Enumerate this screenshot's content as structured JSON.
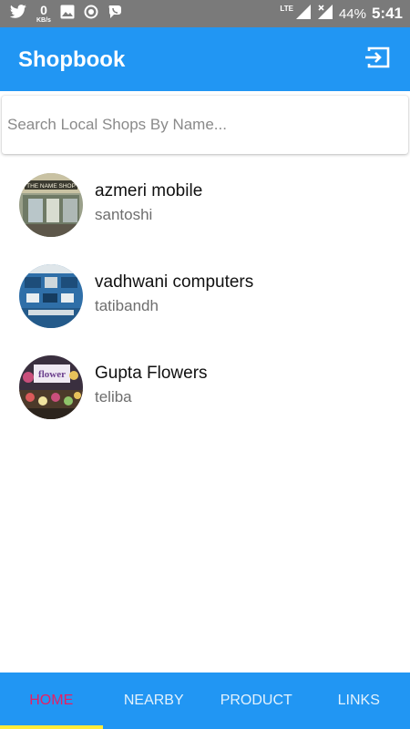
{
  "status_bar": {
    "kbs_value": "0",
    "kbs_unit": "KB/s",
    "network": "LTE",
    "battery": "44%",
    "time": "5:41"
  },
  "app_bar": {
    "title": "Shopbook",
    "action_icon": "logout-icon"
  },
  "search": {
    "placeholder": "Search Local Shops By Name...",
    "value": ""
  },
  "shops": [
    {
      "name": "azmeri mobile",
      "location": "santoshi",
      "sign_text": "THE NAME SHOP"
    },
    {
      "name": "vadhwani computers",
      "location": "tatibandh"
    },
    {
      "name": "Gupta Flowers",
      "location": "teliba",
      "sign_text": "flower"
    }
  ],
  "bottom_nav": {
    "tabs": [
      {
        "label": "HOME",
        "active": true
      },
      {
        "label": "NEARBY",
        "active": false
      },
      {
        "label": "PRODUCT",
        "active": false
      },
      {
        "label": "LINKS",
        "active": false
      }
    ]
  },
  "colors": {
    "primary": "#2196f3",
    "status_bar": "#7a7a7a",
    "active_tab_text": "#e91e63",
    "active_tab_indicator": "#ffeb3b"
  }
}
